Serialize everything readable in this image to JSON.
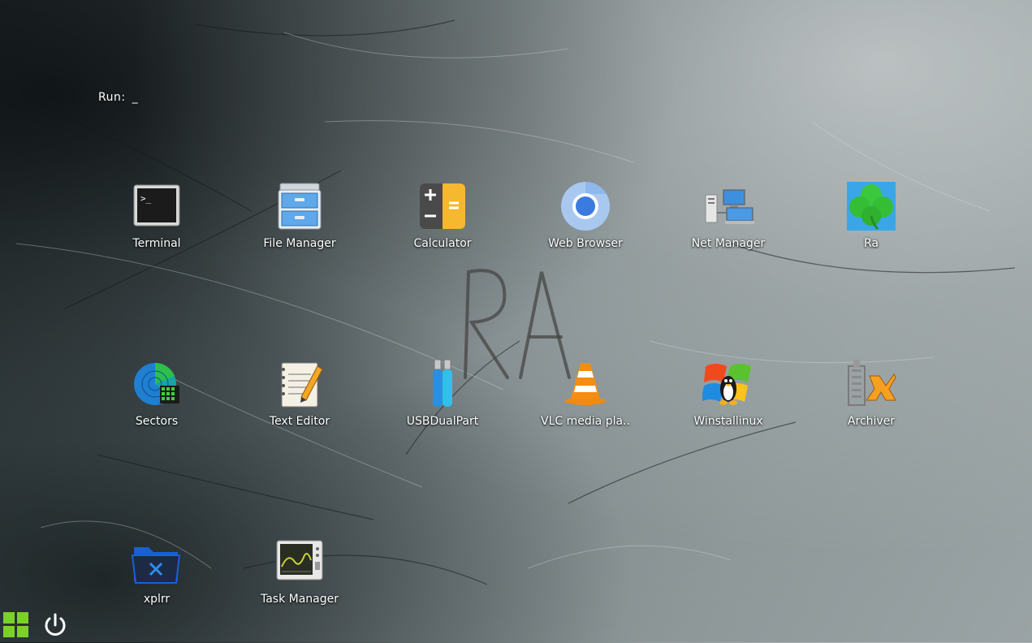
{
  "desktop": {
    "run_label": "Run:",
    "run_cursor": "_",
    "icons": [
      {
        "label": "Terminal",
        "icon": "terminal-icon"
      },
      {
        "label": "File Manager",
        "icon": "file-cabinet-icon"
      },
      {
        "label": "Calculator",
        "icon": "calculator-icon"
      },
      {
        "label": "Web Browser",
        "icon": "chromium-icon"
      },
      {
        "label": "Net Manager",
        "icon": "network-computers-icon"
      },
      {
        "label": "Ra",
        "icon": "clover-icon"
      },
      {
        "label": "Sectors",
        "icon": "disk-sectors-icon"
      },
      {
        "label": "Text Editor",
        "icon": "notepad-pencil-icon"
      },
      {
        "label": "USBDualPart",
        "icon": "usb-drives-icon"
      },
      {
        "label": "VLC media pla..",
        "icon": "vlc-cone-icon"
      },
      {
        "label": "Winstallinux",
        "icon": "windows-tux-icon"
      },
      {
        "label": "Archiver",
        "icon": "archive-zipper-icon"
      },
      {
        "label": "xplrr",
        "icon": "blue-folder-icon"
      },
      {
        "label": "Task Manager",
        "icon": "monitor-graph-icon"
      }
    ]
  },
  "taskbar": {
    "start": "start-grid-icon",
    "power": "power-icon"
  },
  "colors": {
    "start_green": "#7bd12a",
    "calc_orange": "#f5b82e",
    "vlc_orange": "#f08a10",
    "chromium_blue": "#3b7be0"
  }
}
